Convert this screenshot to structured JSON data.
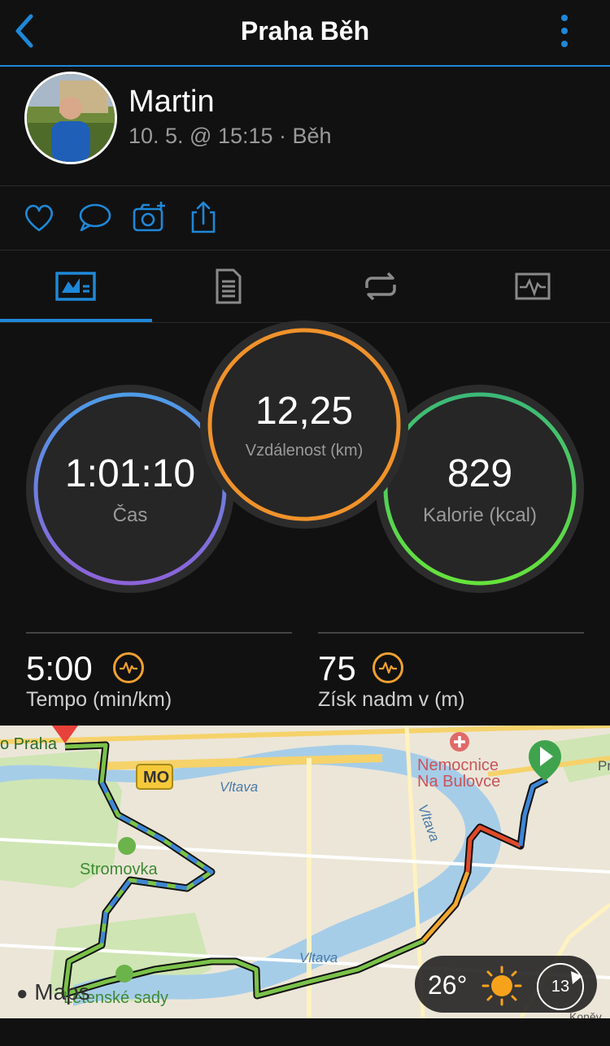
{
  "header": {
    "title": "Praha Běh"
  },
  "profile": {
    "name": "Martin",
    "meta": "10. 5. @ 15:15 · Běh"
  },
  "actions": [
    "heart-icon",
    "comment-icon",
    "camera-add-icon",
    "share-icon"
  ],
  "tabs": [
    "stats-tab-icon",
    "details-tab-icon",
    "laps-tab-icon",
    "charts-tab-icon"
  ],
  "stats": {
    "time": {
      "value": "1:01:10",
      "label": "Čas"
    },
    "distance": {
      "value": "12,25",
      "label": "Vzdálenost (km)"
    },
    "calories": {
      "value": "829",
      "label": "Kalorie (kcal)"
    }
  },
  "metrics": {
    "pace": {
      "value": "5:00",
      "label": "Tempo (min/km)"
    },
    "elevation": {
      "value": "75",
      "label": "Získ nadm v (m)"
    }
  },
  "map": {
    "labels": {
      "praha": "o Praha",
      "mo": "MO",
      "vltava1": "Vltava",
      "vltava2": "Vltava",
      "vltava3": "Vltava",
      "hospital1": "Nemocnice",
      "hospital2": "Na Bulovce",
      "stromovka": "Stromovka",
      "sady": "Letenské sady",
      "pr": "Pr",
      "konev": "Koněv"
    },
    "maps_logo": "Maps",
    "weather": {
      "temp": "26°",
      "wind": "13"
    }
  },
  "colors": {
    "accent": "#1e88d8",
    "time_ring": "#5a8de0",
    "distance_ring": "#f0922b",
    "calories_ring": "#4cd964",
    "pace_icon": "#f0a030"
  }
}
